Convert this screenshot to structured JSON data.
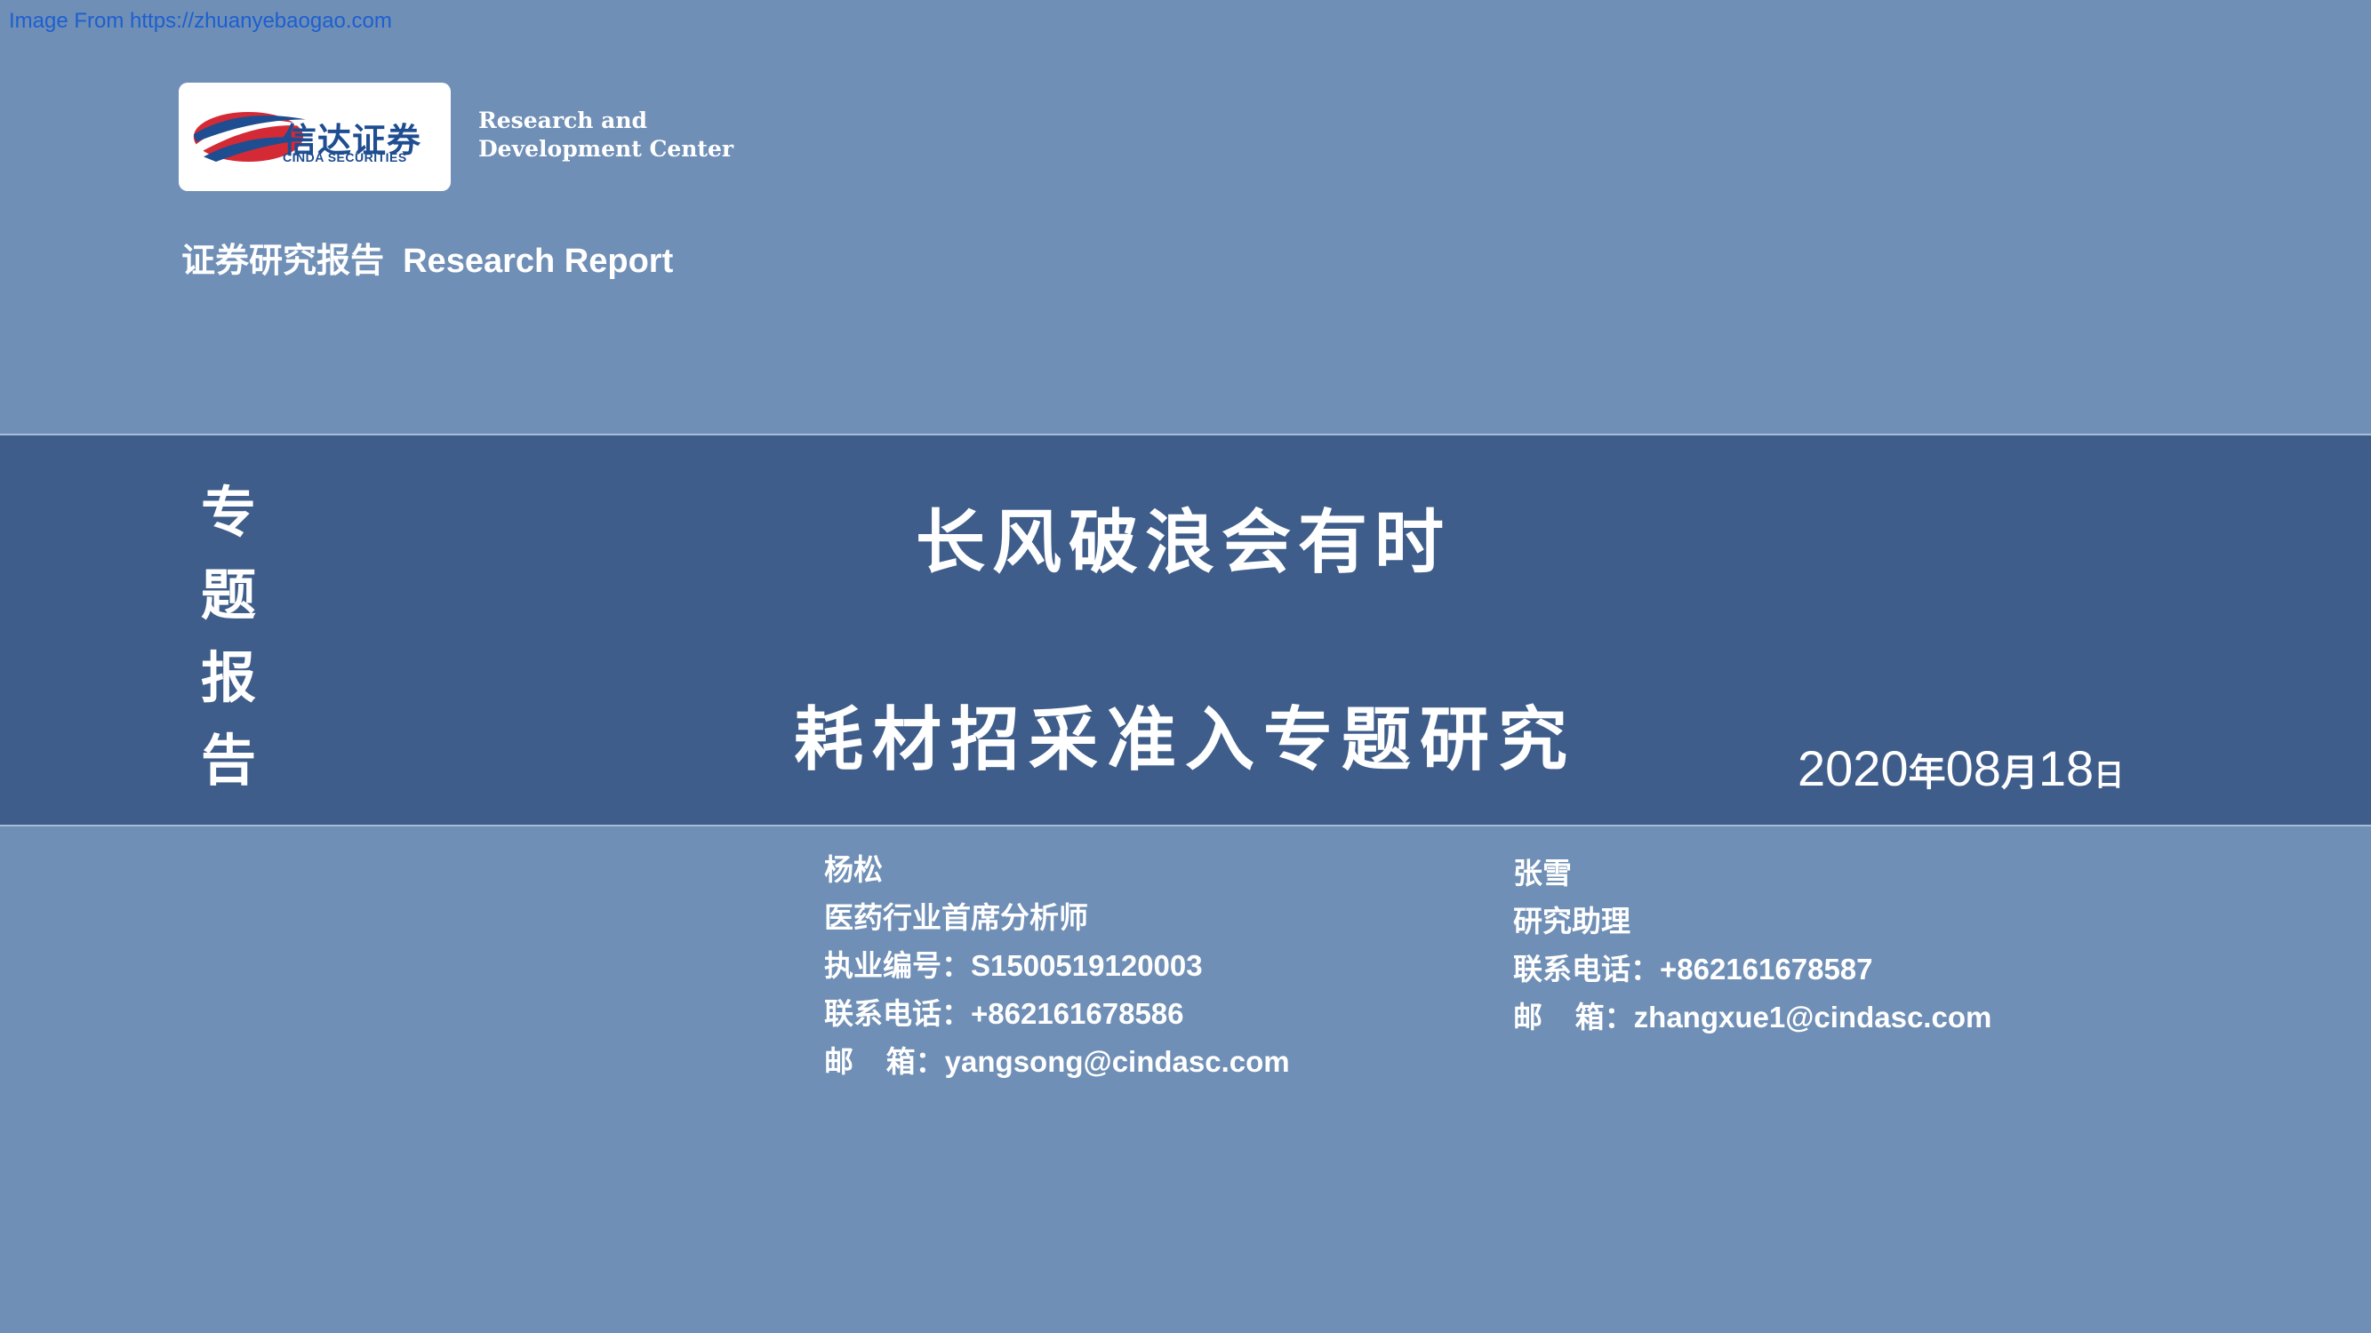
{
  "source_note": "Image From https://zhuanyebaogao.com",
  "logo": {
    "cn": "信达证券",
    "en": "CINDA SECURITIES",
    "colors": {
      "red": "#d42a36",
      "blue": "#1e4d91"
    }
  },
  "rd_center": {
    "line1": "Research and",
    "line2": "Development Center"
  },
  "report_label": "证券研究报告  Research Report",
  "vertical_label": [
    "专",
    "题",
    "报",
    "告"
  ],
  "title": "长风破浪会有时",
  "subtitle": "耗材招采准入专题研究",
  "date": {
    "year": "2020",
    "year_unit": "年",
    "month": "08",
    "month_unit": "月",
    "day": "18",
    "day_unit": "日"
  },
  "authors": [
    {
      "name": "杨松",
      "role": "医药行业首席分析师",
      "cert": "执业编号：S1500519120003",
      "phone": "联系电话：+862161678586",
      "email": "邮    箱：yangsong@cindasc.com"
    },
    {
      "name": "张雪",
      "role": "研究助理",
      "phone": "联系电话：+862161678587",
      "email": "邮    箱：zhangxue1@cindasc.com"
    }
  ],
  "colors": {
    "background": "#6f8fb6",
    "band": "#3e5d8a",
    "link": "#1d5fd0"
  }
}
